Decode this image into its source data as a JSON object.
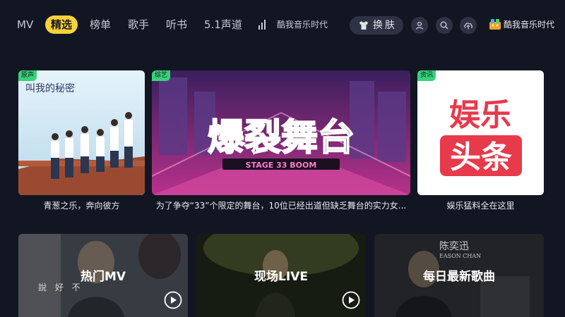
{
  "nav": {
    "tabs": [
      {
        "label": "MV",
        "active": false
      },
      {
        "label": "精选",
        "active": true
      },
      {
        "label": "榜单",
        "active": false
      },
      {
        "label": "歌手",
        "active": false
      },
      {
        "label": "听书",
        "active": false
      },
      {
        "label": "5.1声道",
        "active": false
      }
    ],
    "now_playing_text": "酷我音乐时代",
    "skin_button_label": "换肤",
    "icons": [
      "user-icon",
      "search-icon",
      "cloud-upload-icon"
    ],
    "brand_text": "酷我音乐时代"
  },
  "featured": [
    {
      "tag": "原声",
      "caption": "青葱之乐，奔向彼方",
      "poster_title": "叫我的秘密",
      "tag_color": "#36d27a"
    },
    {
      "tag": "综艺",
      "caption": "为了争夺“33”个限定的舞台，10位已经出道但缺乏舞台的实力女...",
      "poster_title": "爆裂舞台",
      "poster_sub": "STAGE 33 BOOM",
      "tag_color": "#36d27a"
    },
    {
      "tag": "资讯",
      "caption": "娱乐猛料全在这里",
      "poster_line1": "娱乐",
      "poster_line2": "头条",
      "tag_color": "#36d27a"
    }
  ],
  "categories": [
    {
      "title": "热门MV",
      "overlay_text": "說 好 不"
    },
    {
      "title": "现场LIVE"
    },
    {
      "title": "每日最新歌曲",
      "overlay_text": "陈奕迅",
      "overlay_sub": "EASON CHAN"
    }
  ],
  "colors": {
    "accent": "#f7d23a",
    "background": "#121623",
    "tag_green": "#36d27a",
    "poster_red": "#e73a4b"
  }
}
